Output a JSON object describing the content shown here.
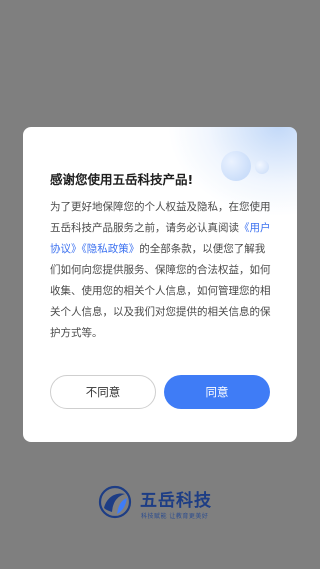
{
  "dialog": {
    "title": "感谢您使用五岳科技产品!",
    "paragraph_start": "为了更好地保障您的个人权益及隐私，在您使用五岳科技产品服务之前，请务必认真阅读",
    "user_agreement": "《用户协议》",
    "privacy_policy": "《隐私政策》",
    "paragraph_end": "的全部条款，以便您了解我们如何向您提供服务、保障您的合法权益，如何收集、使用您的相关个人信息，如何管理您的相关个人信息，以及我们对您提供的相关信息的保护方式等。",
    "disagree_label": "不同意",
    "agree_label": "同意"
  },
  "footer": {
    "brand_name": "五岳科技",
    "slogan": "科技赋能 让教育更美好"
  },
  "colors": {
    "accent": "#3f7cf6",
    "link": "#3d72f0",
    "brand": "#1d3d85",
    "overlay": "#7f7f7f"
  }
}
